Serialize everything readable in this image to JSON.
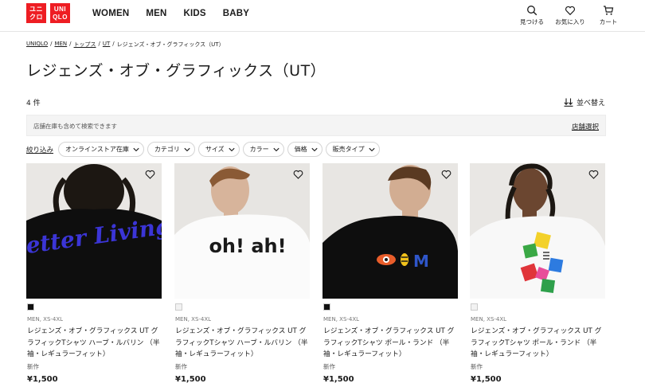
{
  "header": {
    "logo_left": [
      "ユニ",
      "クロ"
    ],
    "logo_right": [
      "UNI",
      "QLO"
    ],
    "nav": [
      "WOMEN",
      "MEN",
      "KIDS",
      "BABY"
    ],
    "icons": [
      {
        "name": "search-icon",
        "label": "見つける"
      },
      {
        "name": "heart-icon",
        "label": "お気に入り"
      },
      {
        "name": "cart-icon",
        "label": "カート"
      }
    ]
  },
  "breadcrumb": [
    "UNIQLO",
    "MEN",
    "トップス",
    "UT",
    "レジェンズ・オブ・グラフィックス（UT）"
  ],
  "page_title": "レジェンズ・オブ・グラフィックス（UT）",
  "result_count": "4 件",
  "sort_label": "並べ替え",
  "store": {
    "text": "店舗在庫も含めて検索できます",
    "link": "店舗選択"
  },
  "filters": {
    "label": "絞り込み",
    "chips": [
      "オンラインストア在庫",
      "カテゴリ",
      "サイズ",
      "カラー",
      "価格",
      "販売タイプ"
    ]
  },
  "products": [
    {
      "swatch": "#111111",
      "gender": "MEN, XS-4XL",
      "name": "レジェンズ・オブ・グラフィックス UT グラフィックTシャツ ハーブ・ルバリン （半袖・レギュラーフィット）",
      "badge": "新作",
      "price": "¥1,500",
      "graphic_text": "Better Living"
    },
    {
      "swatch": "#f2f2f2",
      "gender": "MEN, XS-4XL",
      "name": "レジェンズ・オブ・グラフィックス UT グラフィックTシャツ ハーブ・ルバリン （半袖・レギュラーフィット）",
      "badge": "新作",
      "price": "¥1,500",
      "graphic_text": "oh! ah!"
    },
    {
      "swatch": "#111111",
      "gender": "MEN, XS-4XL",
      "name": "レジェンズ・オブ・グラフィックス UT グラフィックTシャツ ポール・ランド （半袖・レギュラーフィット）",
      "badge": "新作",
      "price": "¥1,500",
      "graphic_text": "M"
    },
    {
      "swatch": "#f2f2f2",
      "gender": "MEN, XS-4XL",
      "name": "レジェンズ・オブ・グラフィックス UT グラフィックTシャツ ポール・ランド （半袖・レギュラーフィット）",
      "badge": "新作",
      "price": "¥1,500",
      "graphic_text": ""
    }
  ],
  "colors": {
    "brand_red": "#ee1d23",
    "text": "#1b1b1b",
    "store_bar_bg": "#f4f4f4"
  }
}
